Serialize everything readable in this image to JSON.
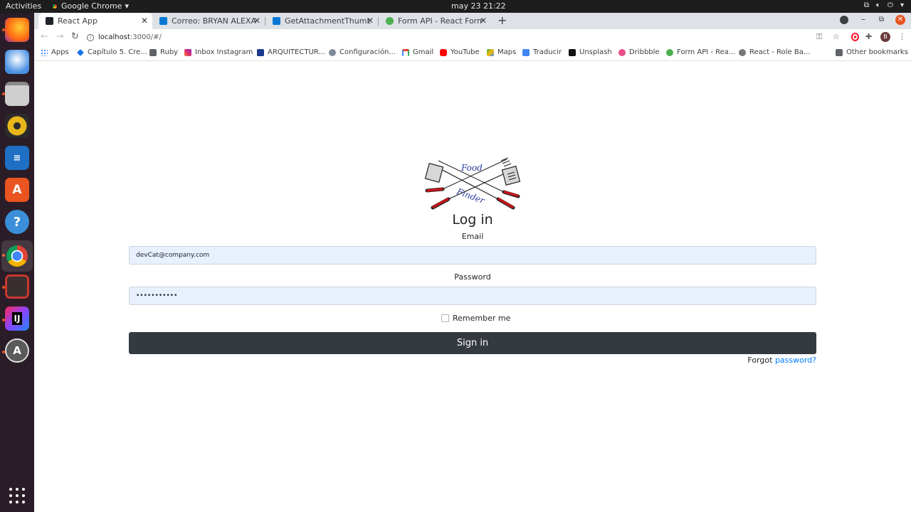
{
  "system_bar": {
    "activities": "Activities",
    "app_name": "Google Chrome",
    "clock": "may 23  21:22"
  },
  "dock": {
    "apps": [
      "firefox-icon",
      "thunderbird-icon",
      "files-icon",
      "rhythmbox-icon",
      "writer-icon",
      "software-icon",
      "help-icon",
      "chrome-icon",
      "terminal-icon",
      "intellij-icon",
      "updater-icon"
    ]
  },
  "browser": {
    "tabs": [
      {
        "title": "React App",
        "favicon_color": "#20232a"
      },
      {
        "title": "Correo: BRYAN ALEXANDE",
        "favicon_color": "#0078d4"
      },
      {
        "title": "GetAttachmentThumbnail",
        "favicon_color": "#0078d4"
      },
      {
        "title": "Form API - React Form Co",
        "favicon_color": "#4caf50"
      }
    ],
    "new_tab": "+",
    "url_host": "localhost",
    "url_path": ":3000/#/",
    "profile_initial": "B",
    "bookmarks": [
      {
        "label": "Apps",
        "color": "#4285f4"
      },
      {
        "label": "Capítulo 5. Cre...",
        "color": "#1a73e8"
      },
      {
        "label": "Ruby",
        "color": "#5f6368"
      },
      {
        "label": "Inbox Instagram",
        "color": "#e1306c"
      },
      {
        "label": "ARQUITECTUR...",
        "color": "#1a3a8f"
      },
      {
        "label": "Configuración...",
        "color": "#7e8a9a"
      },
      {
        "label": "Gmail",
        "color": "#ea4335"
      },
      {
        "label": "YouTube",
        "color": "#ff0000"
      },
      {
        "label": "Maps",
        "color": "#34a853"
      },
      {
        "label": "Traducir",
        "color": "#4285f4"
      },
      {
        "label": "Unsplash",
        "color": "#111111"
      },
      {
        "label": "Dribbble",
        "color": "#ea4c89"
      },
      {
        "label": "Form API - Rea...",
        "color": "#4caf50"
      },
      {
        "label": "React - Role Ba...",
        "color": "#777777"
      }
    ],
    "other_bookmarks": "Other bookmarks"
  },
  "login": {
    "logo_top_text": "Food",
    "logo_bottom_text": "Finder",
    "title": "Log in",
    "email_label": "Email",
    "email_value": "devCat@company.com",
    "password_label": "Password",
    "password_value": "•••••••••••",
    "remember_label": "Remember me",
    "signin_label": "Sign in",
    "forgot_prefix": "Forgot ",
    "forgot_link": "password?"
  }
}
